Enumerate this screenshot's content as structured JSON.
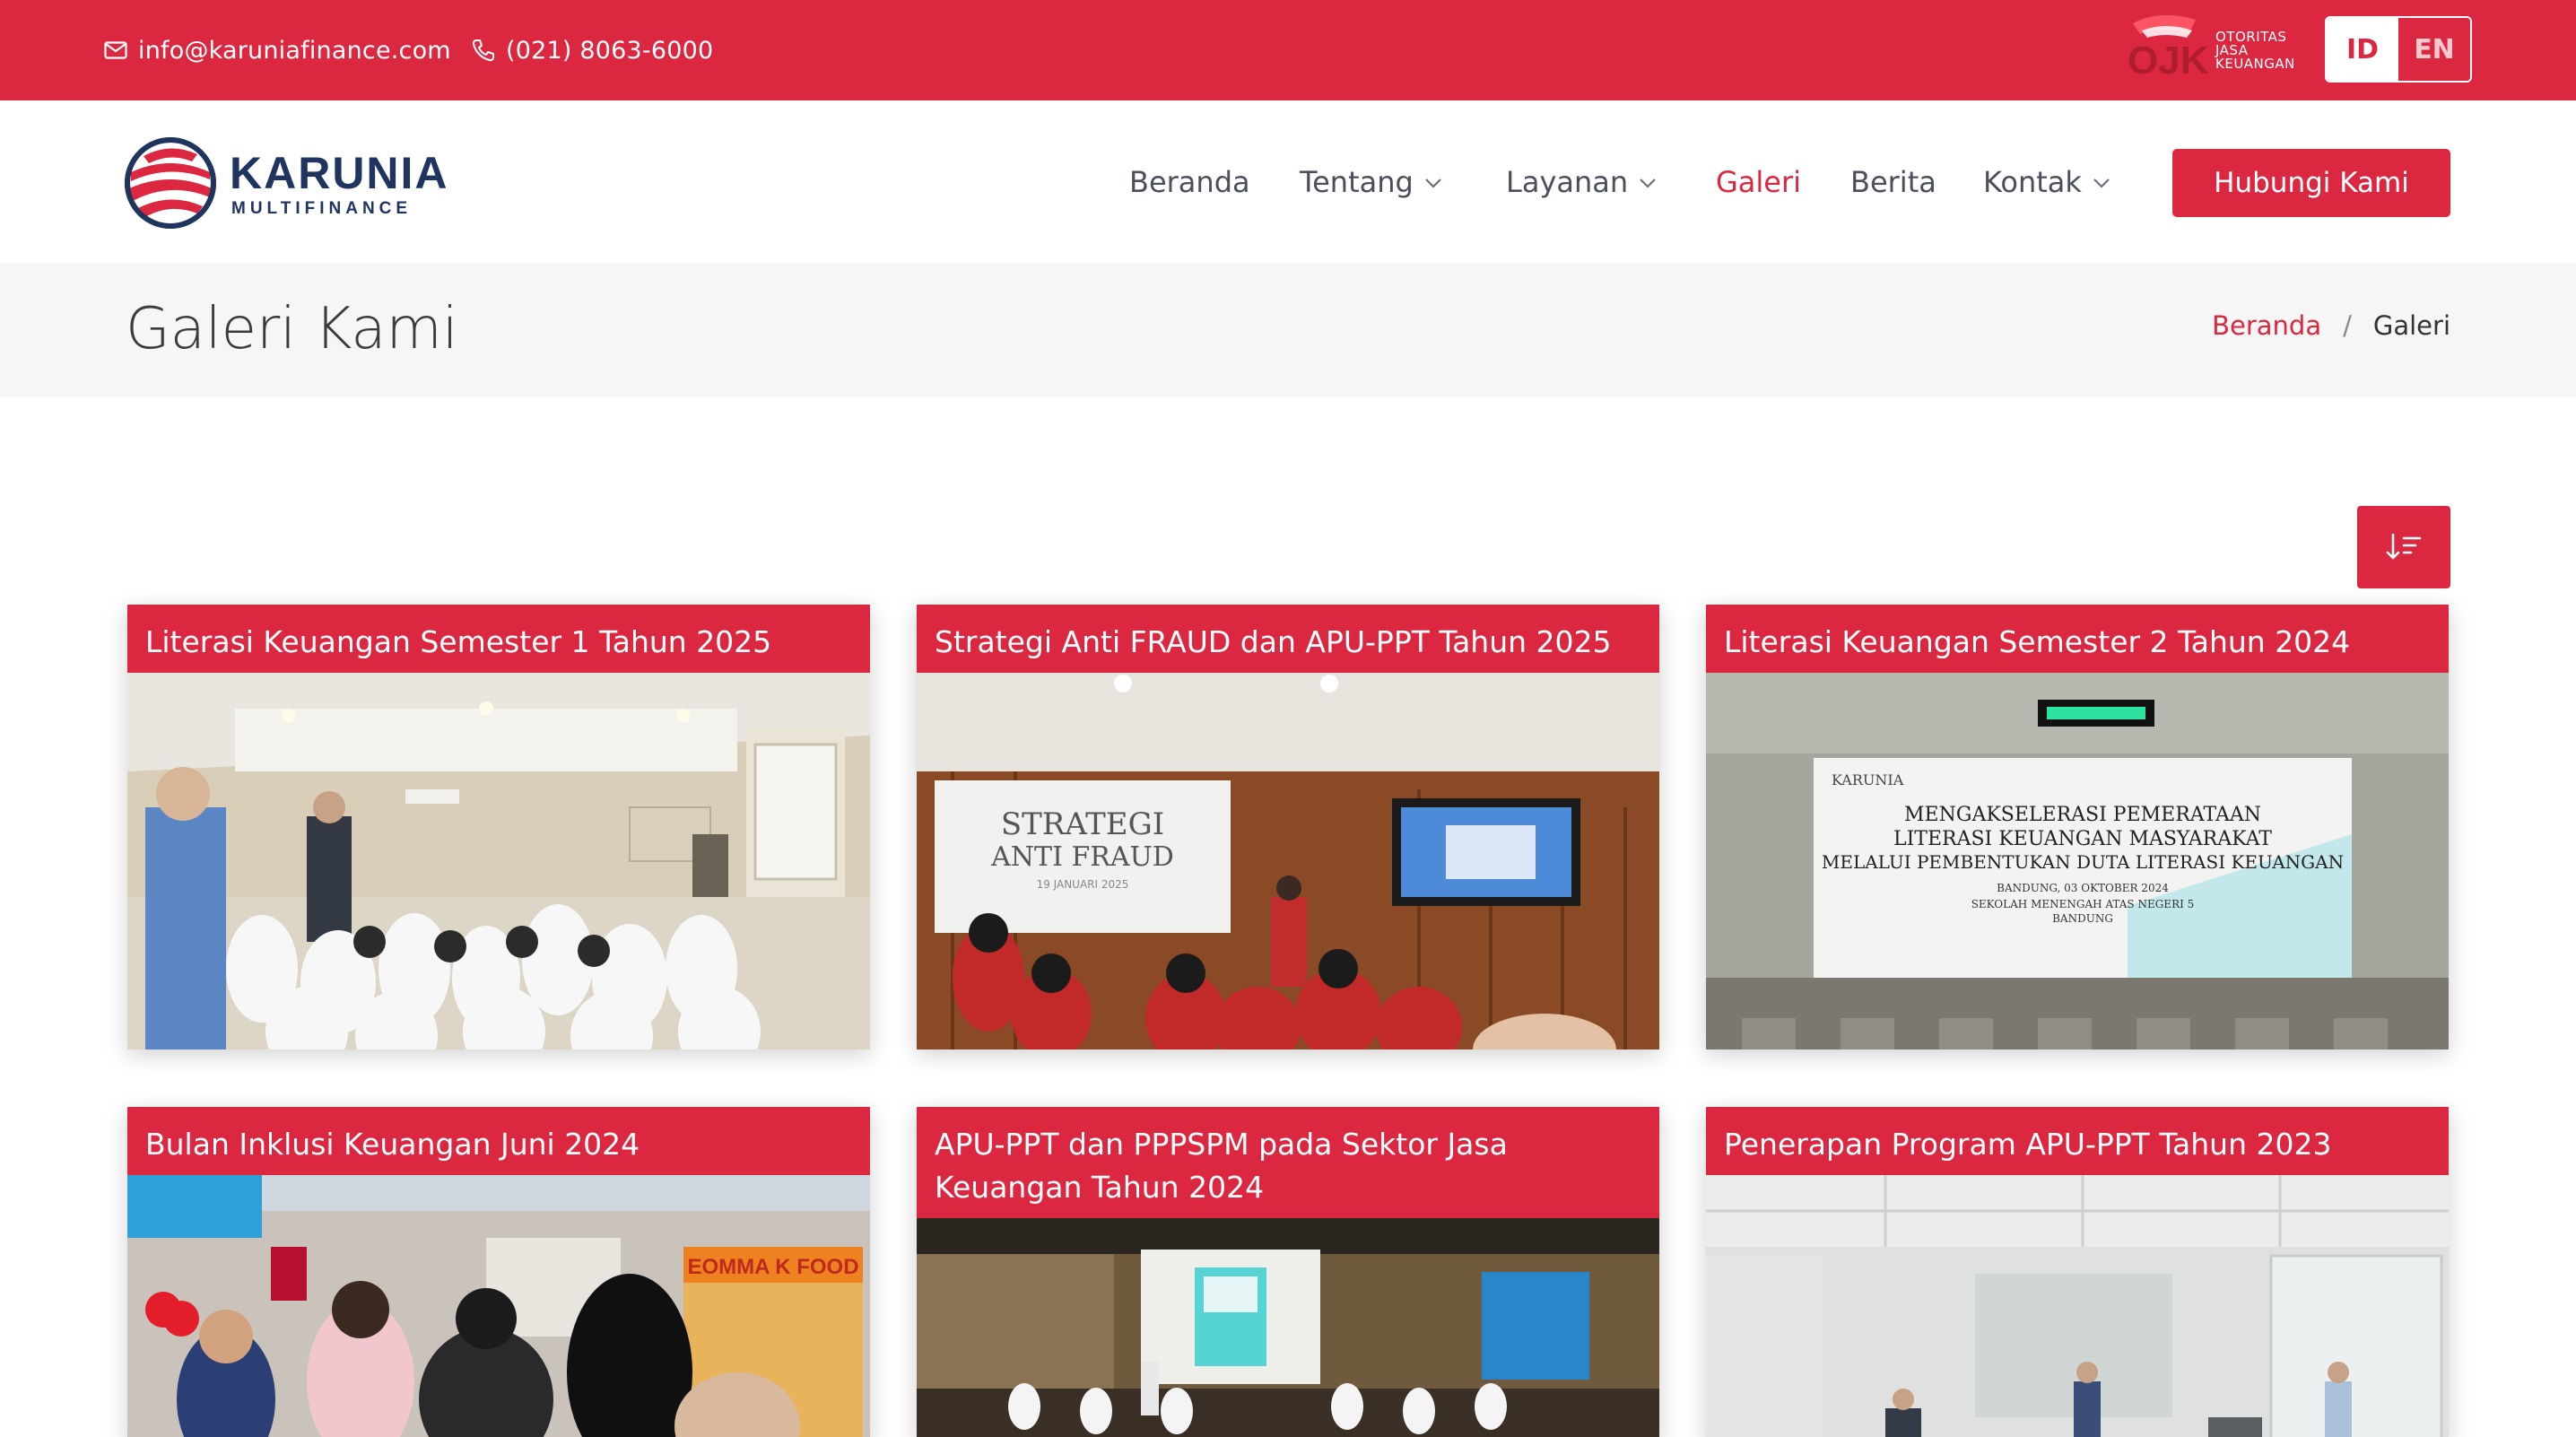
{
  "topbar": {
    "email": "info@karuniafinance.com",
    "phone": "(021) 8063-6000",
    "regulator_lines": [
      "OTORITAS",
      "JASA",
      "KEUANGAN"
    ],
    "regulator_mark": "OJK",
    "lang_id": "ID",
    "lang_en": "EN"
  },
  "header": {
    "logo_line1": "KARUNIA",
    "logo_line2": "MULTIFINANCE",
    "nav": [
      {
        "label": "Beranda",
        "dropdown": false,
        "active": false
      },
      {
        "label": "Tentang",
        "dropdown": true,
        "active": false
      },
      {
        "label": "Layanan",
        "dropdown": true,
        "active": false
      },
      {
        "label": "Galeri",
        "dropdown": false,
        "active": true
      },
      {
        "label": "Berita",
        "dropdown": false,
        "active": false
      },
      {
        "label": "Kontak",
        "dropdown": true,
        "active": false
      }
    ],
    "cta_label": "Hubungi Kami"
  },
  "page": {
    "title": "Galeri Kami",
    "breadcrumb_home": "Beranda",
    "breadcrumb_sep": "/",
    "breadcrumb_current": "Galeri"
  },
  "gallery": {
    "sort_icon": "sort-descending-icon",
    "items": [
      {
        "title": "Literasi Keuangan Semester 1 Tahun 2025"
      },
      {
        "title": "Strategi Anti FRAUD dan APU-PPT Tahun 2025",
        "banner_line1": "STRATEGI",
        "banner_line2": "ANTI FRAUD",
        "banner_date": "19 JANUARI 2025"
      },
      {
        "title": "Literasi Keuangan Semester 2 Tahun 2024",
        "banner_brand": "KARUNIA",
        "banner_line1": "MENGAKSELERASI PEMERATAAN",
        "banner_line2": "LITERASI KEUANGAN MASYARAKAT",
        "banner_line3": "MELALUI PEMBENTUKAN DUTA LITERASI KEUANGAN",
        "banner_line4": "BANDUNG, 03 OKTOBER 2024",
        "banner_line5": "SEKOLAH MENENGAH ATAS NEGERI 5",
        "banner_line6": "BANDUNG"
      },
      {
        "title": "Bulan Inklusi Keuangan Juni 2024",
        "sign_text": "EOMMA K FOOD"
      },
      {
        "title": "APU-PPT dan PPPSPM pada Sektor Jasa Keuangan Tahun 2024"
      },
      {
        "title": "Penerapan Program APU-PPT Tahun 2023"
      }
    ]
  },
  "colors": {
    "brand_red": "#dc2741",
    "title_band": "#f6f6f6",
    "logo_navy": "#1f3560"
  }
}
